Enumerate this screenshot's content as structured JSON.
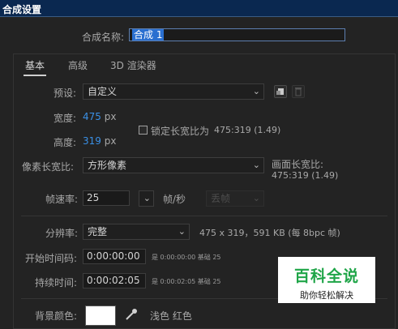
{
  "window": {
    "title": "合成设置"
  },
  "comp_name": {
    "label": "合成名称:",
    "value": "合成 1"
  },
  "tabs": [
    {
      "label": "基本",
      "active": true
    },
    {
      "label": "高级",
      "active": false
    },
    {
      "label": "3D 渲染器",
      "active": false
    }
  ],
  "preset": {
    "label": "预设:",
    "value": "自定义"
  },
  "width": {
    "label": "宽度:",
    "value": "475",
    "unit": "px"
  },
  "height": {
    "label": "高度:",
    "value": "319",
    "unit": "px"
  },
  "lock_aspect": {
    "label": "锁定长宽比为",
    "value": "475:319 (1.49)",
    "checked": false
  },
  "pixel_aspect": {
    "label": "像素长宽比:",
    "value": "方形像素"
  },
  "frame_aspect": {
    "label": "画面长宽比:",
    "value": "475:319 (1.49)"
  },
  "frame_rate": {
    "label": "帧速率:",
    "value": "25",
    "unit": "帧/秒",
    "drop_frame": "丢帧"
  },
  "resolution": {
    "label": "分辨率:",
    "value": "完整",
    "info": "475 x 319，591 KB (每 8bpc 帧)"
  },
  "start_timecode": {
    "label": "开始时间码:",
    "value": "0:00:00:00",
    "note": "是 0:00:00:00  基础 25"
  },
  "duration": {
    "label": "持续时间:",
    "value": "0:00:02:05",
    "note": "是 0:00:02:05  基础 25"
  },
  "background": {
    "label": "背景颜色:",
    "color_name": "浅色 红色",
    "color": "#ffffff"
  },
  "watermark": {
    "title": "百科全说",
    "subtitle": "助你轻松解决"
  },
  "colors": {
    "accent_blue": "#3a90e6",
    "title_bar": "#0a2850",
    "watermark_green": "#1fa548"
  }
}
